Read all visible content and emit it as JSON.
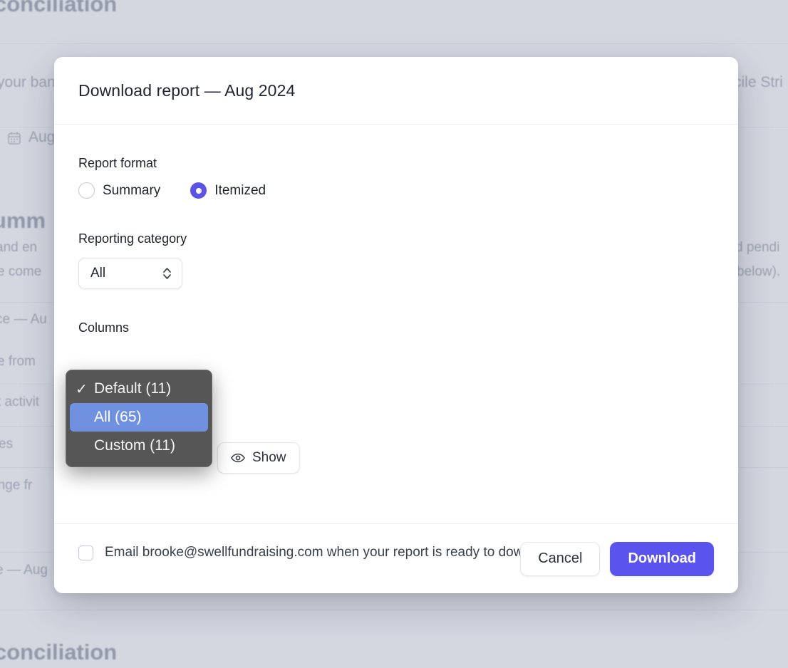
{
  "background": {
    "title_top": "conciliation",
    "title_bottom": "conciliation",
    "line_bank": "your ban",
    "line_stripe": "cile Stri",
    "date_chip": "Aug",
    "calendar_icon": "calendar-icon",
    "summary_heading": "umm",
    "line_and_en": "and en",
    "line_come": "e come",
    "line_pending": "d pendi",
    "line_below": "below).",
    "row_balance": "ce — Au",
    "row_from": "e from",
    "row_activity": "t activit",
    "row_es": "es",
    "row_change": "ange fr",
    "row_aug": "e — Aug"
  },
  "modal": {
    "title": "Download report — Aug 2024",
    "report_format": {
      "label": "Report format",
      "options": [
        {
          "label": "Summary",
          "selected": false
        },
        {
          "label": "Itemized",
          "selected": true
        }
      ]
    },
    "reporting_category": {
      "label": "Reporting category",
      "value": "All",
      "chevron_icon": "chevron-up-down-icon"
    },
    "columns": {
      "label": "Columns",
      "show_button": {
        "label": "Show",
        "icon": "eye-icon"
      },
      "menu": {
        "items": [
          {
            "label": "Default (11)",
            "checked": true,
            "highlighted": false
          },
          {
            "label": "All (65)",
            "checked": false,
            "highlighted": true
          },
          {
            "label": "Custom (11)",
            "checked": false,
            "highlighted": false
          }
        ],
        "check_glyph": "✓"
      }
    },
    "email_option": {
      "checked": false,
      "text": "Email brooke@swellfundraising.com when your report is ready to download"
    },
    "footer": {
      "cancel_label": "Cancel",
      "download_label": "Download"
    }
  },
  "colors": {
    "accent_purple": "#5b53ee",
    "radio_selected": "#5b53e8",
    "menu_background": "#565656",
    "menu_highlight": "#6f91e0",
    "page_background": "#d3d7e0"
  }
}
